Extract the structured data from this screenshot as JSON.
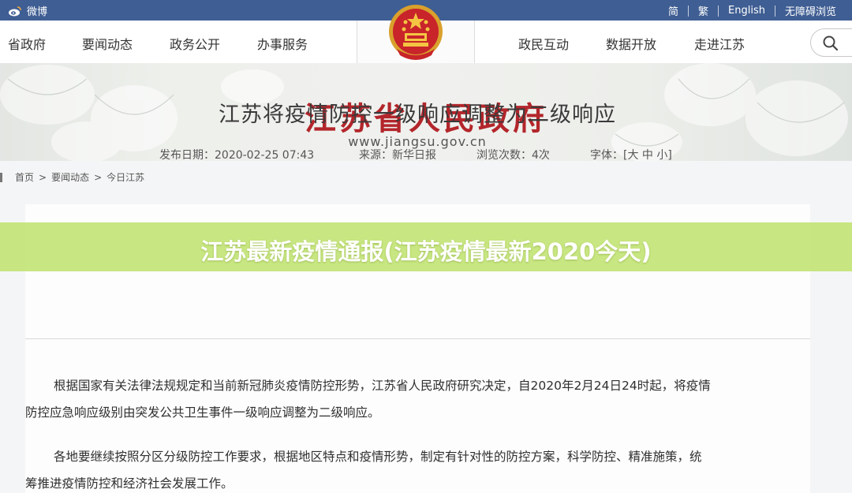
{
  "topbar": {
    "weibo_label": "微博",
    "links": [
      "简",
      "繁",
      "English",
      "无障碍浏览"
    ]
  },
  "nav": {
    "left_items": [
      "省政府",
      "要闻动态",
      "政务公开",
      "办事服务"
    ],
    "right_items": [
      "政民互动",
      "数据开放",
      "走进江苏"
    ]
  },
  "banner": {
    "title": "江苏省人民政府",
    "url": "www.jiangsu.gov.cn"
  },
  "breadcrumb": [
    "首页",
    ">",
    "要闻动态",
    ">",
    "今日江苏"
  ],
  "overlay_headline": "江苏最新疫情通报(江苏疫情最新2020今天)",
  "article": {
    "title": "江苏将疫情防控一级响应调整为二级响应",
    "meta": {
      "date": "发布日期：2020-02-25 07:43",
      "source": "来源：新华日报",
      "views": "浏览次数：4次",
      "font_label": "字体：[",
      "font_large": "大",
      "font_medium": "中",
      "font_small": "小",
      "font_close": "]"
    },
    "paragraphs": [
      [
        "根据国家有关法律法规规定和当前新冠肺炎疫情防控形势，江苏省人民政府研究决定，自2020年2月24日24时起，将疫情",
        "防控应急响应级别由突发公共卫生事件一级响应调整为二级响应。"
      ],
      [
        "各地要继续按照分区分级防控工作要求，根据地区特点和疫情形势，制定有针对性的防控方案，科学防控、精准施策，统",
        "筹推进疫情防控和经济社会发展工作。"
      ]
    ]
  },
  "icons": {
    "weibo": "weibo-icon",
    "search": "search-icon",
    "emblem": "national-emblem-icon"
  },
  "colors": {
    "topbar": "#3f5e93",
    "banner_title": "#b3262b",
    "overlay": "#c0e270"
  }
}
